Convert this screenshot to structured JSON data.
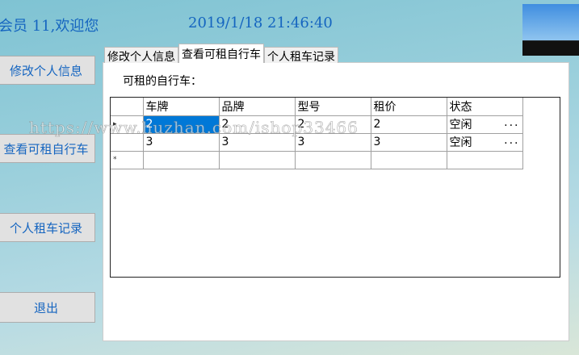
{
  "header": {
    "welcome": "会员 11,欢迎您",
    "datetime": "2019/1/18 21:46:40"
  },
  "sidebar": [
    "修改个人信息",
    "查看可租自行车",
    "个人租车记录",
    "退出"
  ],
  "tabs": [
    "修改个人信息",
    "查看可租自行车",
    "个人租车记录"
  ],
  "panel": {
    "label": "可租的自行车：",
    "columns": [
      "车牌",
      "品牌",
      "型号",
      "租价",
      "状态"
    ],
    "rows": [
      [
        "2",
        "2",
        "2",
        "2",
        "空闲"
      ],
      [
        "3",
        "3",
        "3",
        "3",
        "空闲"
      ]
    ],
    "ellipsis": "...",
    "current_row_marker": "▸",
    "new_row_marker": "*"
  },
  "watermark": "https://www.huzhan.com/ishop33466",
  "colors": {
    "accent": "#1565c0",
    "selection": "#0078d7"
  }
}
